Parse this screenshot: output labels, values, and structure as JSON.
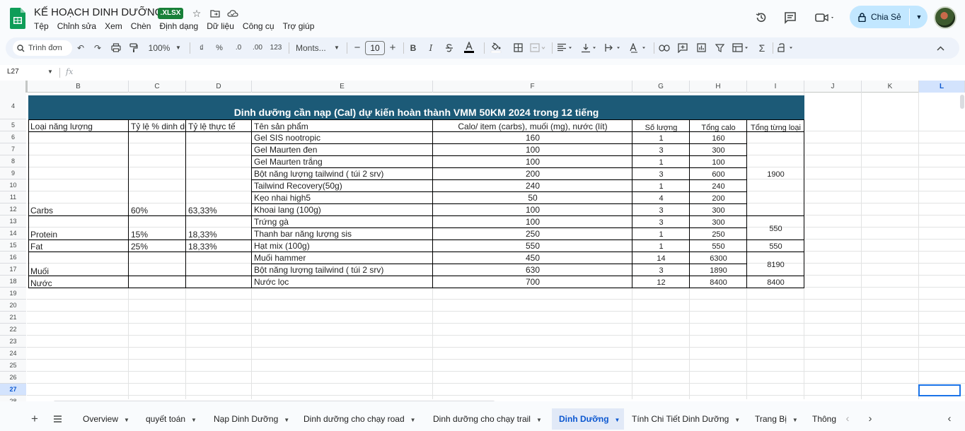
{
  "doc": {
    "title": "KẾ HOẠCH DINH DƯỠNG",
    "badge": ".XLSX"
  },
  "menu": [
    "Tệp",
    "Chỉnh sửa",
    "Xem",
    "Chèn",
    "Định dạng",
    "Dữ liệu",
    "Công cụ",
    "Trợ giúp"
  ],
  "share": {
    "label": "Chia Sẻ"
  },
  "toolbar": {
    "search_label": "Trình đơn",
    "zoom": "100%",
    "currency": "₫",
    "percent": "%",
    "dec_decrease": ".0",
    "dec_increase": ".00",
    "number_format": "123",
    "font": "Monts...",
    "font_size": "10",
    "bold": "B",
    "italic": "I"
  },
  "formula_bar": {
    "namebox": "L27",
    "fx": "fx"
  },
  "columns": [
    {
      "label": "B"
    },
    {
      "label": "C"
    },
    {
      "label": "D"
    },
    {
      "label": "E"
    },
    {
      "label": "F"
    },
    {
      "label": "G"
    },
    {
      "label": "H"
    },
    {
      "label": "I"
    },
    {
      "label": "J"
    },
    {
      "label": "K"
    },
    {
      "label": "L"
    }
  ],
  "rows": [
    "4",
    "5",
    "6",
    "7",
    "8",
    "9",
    "10",
    "11",
    "12",
    "13",
    "14",
    "15",
    "16",
    "17",
    "18",
    "19",
    "20",
    "21",
    "22",
    "23",
    "24",
    "25",
    "26",
    "27",
    "28"
  ],
  "table": {
    "title": "Dinh dưỡng cần nạp (Cal) dự kiến hoàn thành VMM 50KM 2024 trong 12 tiếng",
    "headers": {
      "b": "Loại năng lượng",
      "c": "Tỷ lệ % dinh dưỡng",
      "d": "Tỷ lệ thực tế",
      "e": "Tên sản phẩm",
      "f": "Calo/ item (carbs), muối (mg), nước (lít)",
      "g": "Số lượng",
      "h": "Tổng calo",
      "i": "Tổng từng loại"
    },
    "groups": [
      {
        "b": "Carbs",
        "c": "60%",
        "d": "63,33%",
        "i": "1900"
      },
      {
        "b": "Protein",
        "c": "15%",
        "d": "18,33%",
        "i": "550"
      },
      {
        "b": "Fat",
        "c": "25%",
        "d": "18,33%",
        "i": "550"
      },
      {
        "b": "Muối",
        "c": "",
        "d": "",
        "i": "8190"
      },
      {
        "b": "Nước",
        "c": "",
        "d": "",
        "i": "8400"
      }
    ],
    "items": [
      {
        "e": "Gel SIS nootropic",
        "f": "160",
        "g": "1",
        "h": "160"
      },
      {
        "e": "Gel Maurten đen",
        "f": "100",
        "g": "3",
        "h": "300"
      },
      {
        "e": "Gel Maurten trắng",
        "f": "100",
        "g": "1",
        "h": "100"
      },
      {
        "e": "Bột năng lượng tailwind ( túi 2 srv)",
        "f": "200",
        "g": "3",
        "h": "600"
      },
      {
        "e": "Tailwind Recovery(50g)",
        "f": "240",
        "g": "1",
        "h": "240"
      },
      {
        "e": "Kẹo nhai high5",
        "f": "50",
        "g": "4",
        "h": "200"
      },
      {
        "e": "Khoai lang (100g)",
        "f": "100",
        "g": "3",
        "h": "300"
      },
      {
        "e": "Trứng gà",
        "f": "100",
        "g": "3",
        "h": "300"
      },
      {
        "e": "Thanh bar năng lượng sis",
        "f": "250",
        "g": "1",
        "h": "250"
      },
      {
        "e": "Hạt mix (100g)",
        "f": "550",
        "g": "1",
        "h": "550"
      },
      {
        "e": "Muối hammer",
        "f": "450",
        "g": "14",
        "h": "6300"
      },
      {
        "e": "Bột năng lượng tailwind ( túi 2 srv)",
        "f": "630",
        "g": "3",
        "h": "1890"
      },
      {
        "e": "Nước lọc",
        "f": "700",
        "g": "12",
        "h": "8400"
      }
    ]
  },
  "sheets": [
    {
      "label": "Overview"
    },
    {
      "label": "quyết toán"
    },
    {
      "label": "Nạp Dinh Dưỡng"
    },
    {
      "label": "Dinh dưỡng cho chạy road"
    },
    {
      "label": "Dinh dưỡng cho chạy trail"
    },
    {
      "label": "Dinh Dưỡng"
    },
    {
      "label": "Tính Chi Tiết Dinh Dưỡng"
    },
    {
      "label": "Trang Bị"
    },
    {
      "label": "Thông"
    }
  ]
}
